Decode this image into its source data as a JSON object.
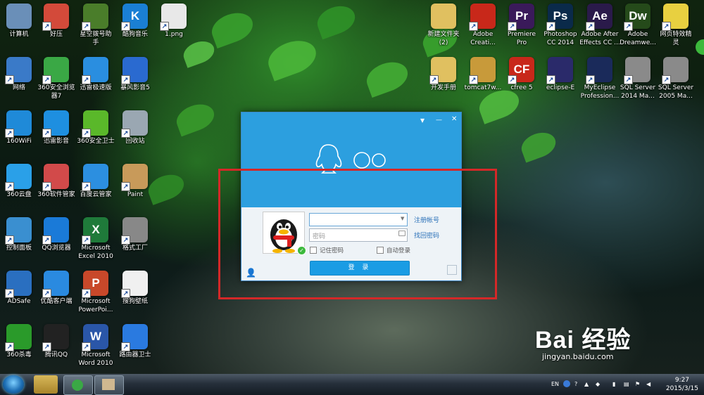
{
  "desktop_icons_left": [
    {
      "label": "计算机",
      "color": "#6a8fb8"
    },
    {
      "label": "好压",
      "color": "#d34a3a"
    },
    {
      "label": "星空拨号助\n手",
      "color": "#4a7d2a"
    },
    {
      "label": "酷狗音乐",
      "color": "#1a7fd4",
      "glyph": "K"
    },
    {
      "label": "1.png",
      "color": "#e8e8e8"
    },
    {
      "label": "网络",
      "color": "#3a7ac8"
    },
    {
      "label": "360安全浏览\n器7",
      "color": "#3aa845"
    },
    {
      "label": "迅雷极速版",
      "color": "#2a8ee0"
    },
    {
      "label": "暴风影音5",
      "color": "#2a6ad0"
    },
    {
      "label": "160WiFi",
      "color": "#1f8ad8"
    },
    {
      "label": "迅雷影音",
      "color": "#1e8fe0"
    },
    {
      "label": "360安全卫士",
      "color": "#5ab82a"
    },
    {
      "label": "回收站",
      "color": "#9aa7b2"
    },
    {
      "label": "360云盘",
      "color": "#2aa0e8"
    },
    {
      "label": "360软件管家",
      "color": "#d24a4a"
    },
    {
      "label": "百度云管家",
      "color": "#2c8fe0"
    },
    {
      "label": "Paint",
      "color": "#c89a5a"
    },
    {
      "label": "控制面板",
      "color": "#3a8fd0"
    },
    {
      "label": "QQ浏览器",
      "color": "#1a7ad8"
    },
    {
      "label": "Microsoft\nExcel 2010",
      "color": "#1f7a3a",
      "glyph": "X"
    },
    {
      "label": "格式工厂",
      "color": "#888888"
    },
    {
      "label": "ADSafe",
      "color": "#2a6fc0"
    },
    {
      "label": "优酷客户端",
      "color": "#2a8ae0"
    },
    {
      "label": "Microsoft\nPowerPoi...",
      "color": "#c8482a",
      "glyph": "P"
    },
    {
      "label": "搜狗壁纸",
      "color": "#f0f0f0"
    },
    {
      "label": "360杀毒",
      "color": "#2a9a2a"
    },
    {
      "label": "腾讯QQ",
      "color": "#222222"
    },
    {
      "label": "Microsoft\nWord 2010",
      "color": "#2a56a8",
      "glyph": "W"
    },
    {
      "label": "路由器卫士",
      "color": "#2a7ae0"
    }
  ],
  "desktop_icons_right": [
    {
      "label": "新建文件夹\n(2)",
      "color": "#e0c060"
    },
    {
      "label": "Adobe\nCreati...",
      "color": "#c8281a"
    },
    {
      "label": "Premiere\nPro",
      "color": "#3a1a5a",
      "glyph": "Pr"
    },
    {
      "label": "Photoshop\nCC 2014",
      "color": "#0a2a4a",
      "glyph": "Ps"
    },
    {
      "label": "Adobe After\nEffects CC ...",
      "color": "#2a1a4a",
      "glyph": "Ae"
    },
    {
      "label": "Adobe\nDreamwe...",
      "color": "#254a1a",
      "glyph": "Dw"
    },
    {
      "label": "网页特效精\n灵",
      "color": "#e8d040"
    },
    {
      "label": "开发手册",
      "color": "#e0c060"
    },
    {
      "label": "tomcat7w...",
      "color": "#c89a3a"
    },
    {
      "label": "cfree 5",
      "color": "#c8281a",
      "glyph": "CF"
    },
    {
      "label": "eclipse-E",
      "color": "#2a2a6a"
    },
    {
      "label": "MyEclipse\nProfession...",
      "color": "#1a2a5a"
    },
    {
      "label": "SQL Server\n2014 Ma...",
      "color": "#8a8a8a"
    },
    {
      "label": "SQL Server\n2005 Ma...",
      "color": "#8a8a8a"
    }
  ],
  "qq_window": {
    "logo_text": "QQ",
    "account_placeholder": "",
    "password_placeholder": "密码",
    "register_link": "注册帐号",
    "recover_link": "找回密码",
    "remember_password": "记住密码",
    "auto_login": "自动登录",
    "login_button": "登 录",
    "minimize": "—",
    "close": "✕",
    "menu": "▾"
  },
  "taskbar": {
    "lang": "EN",
    "time": "9:27",
    "date": "2015/3/15"
  },
  "watermark": {
    "brand": "Bai 经验",
    "url": "jingyan.baidu.com"
  }
}
